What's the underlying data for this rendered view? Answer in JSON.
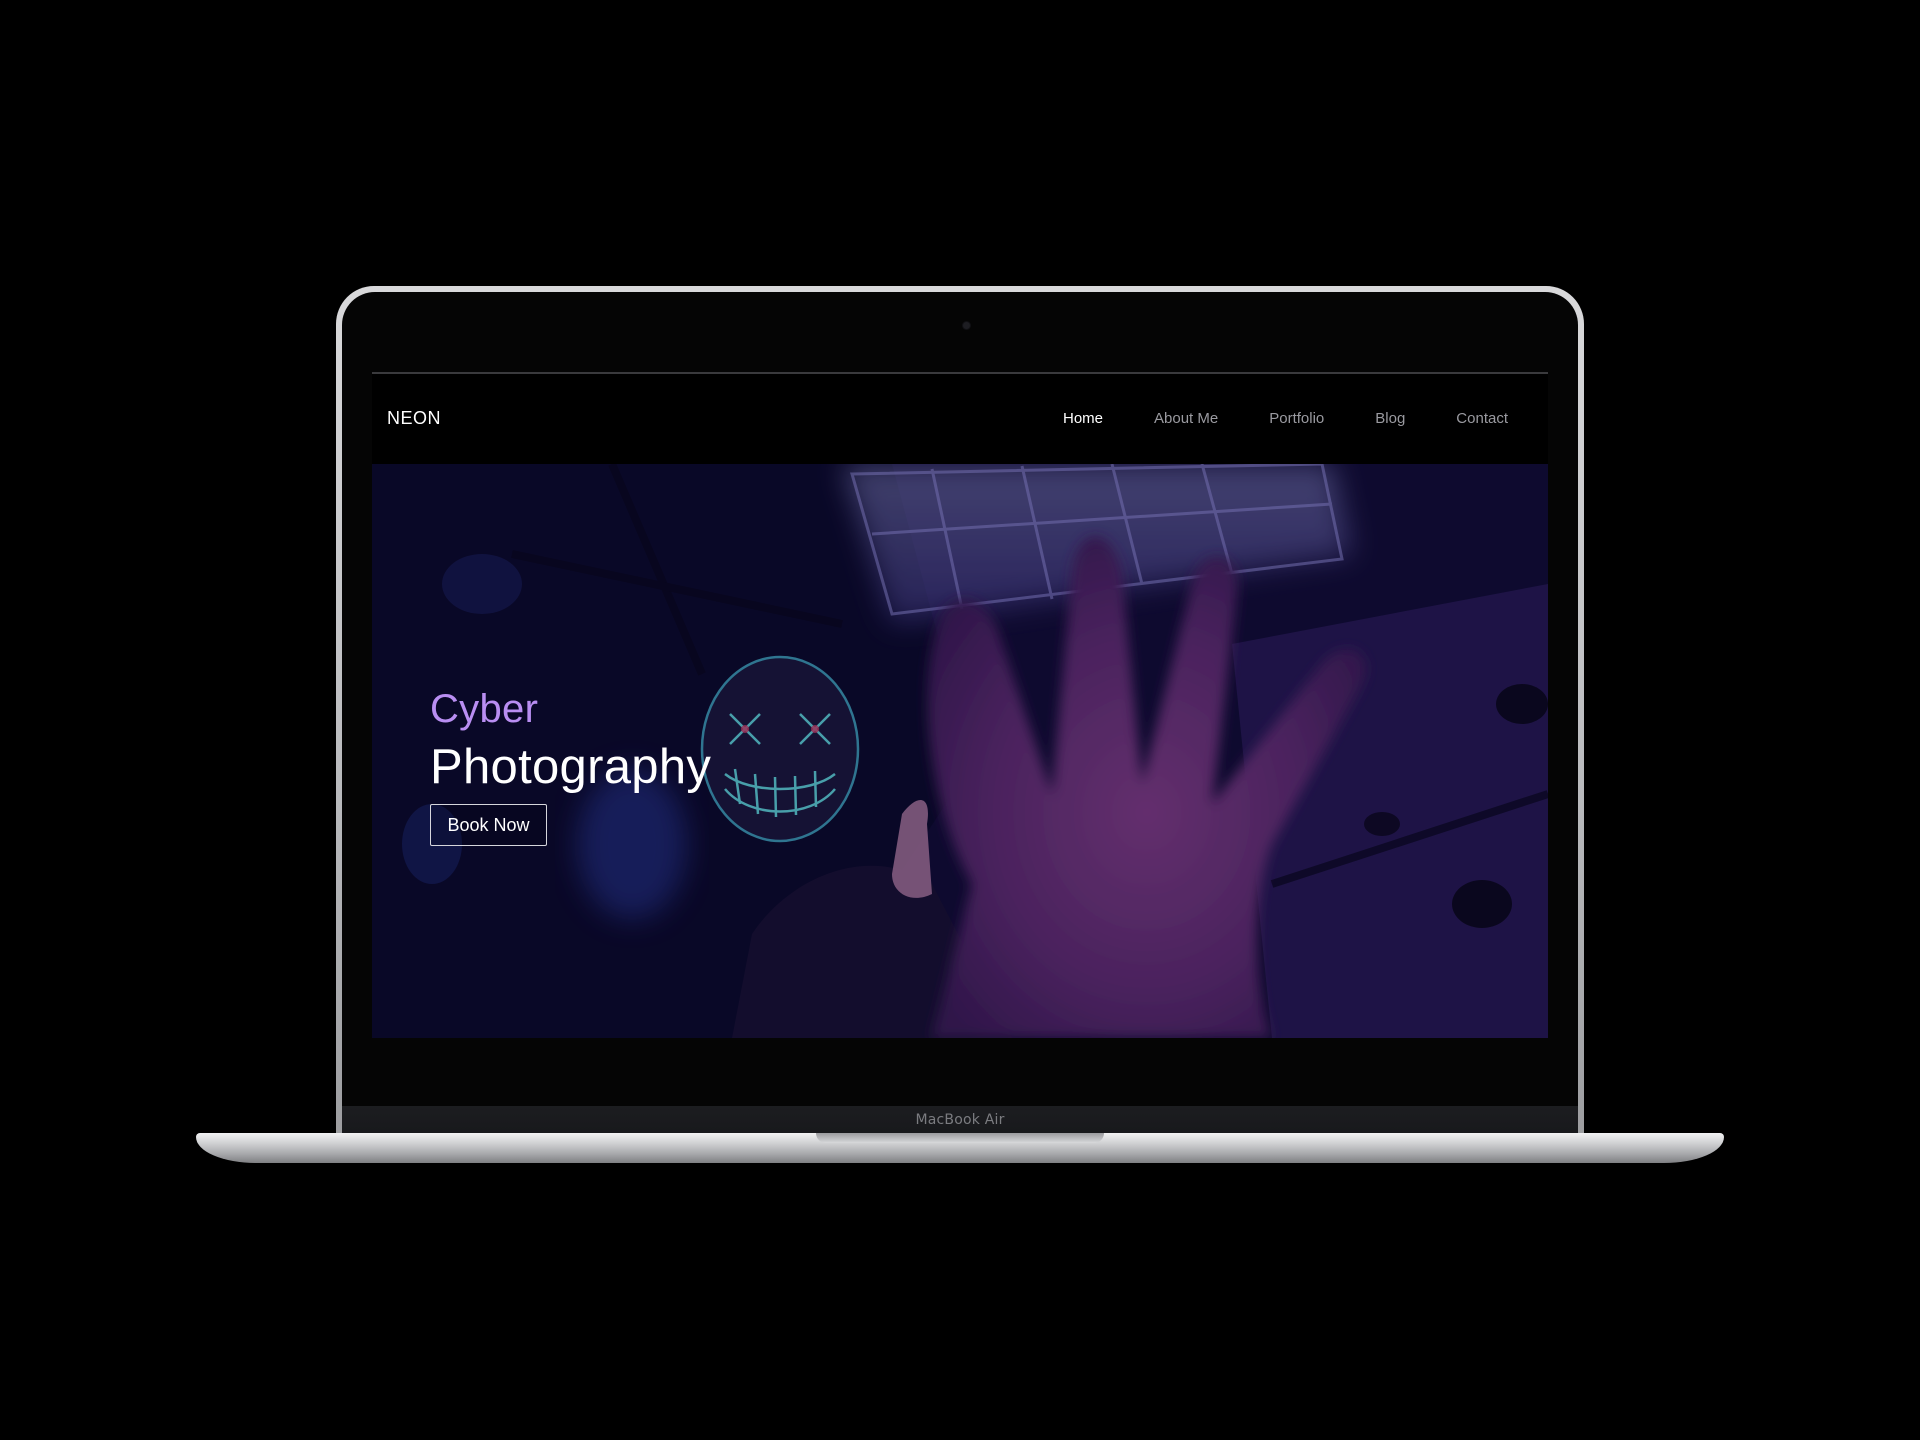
{
  "device": {
    "label": "MacBook Air"
  },
  "site": {
    "brand": "NEON",
    "nav": [
      {
        "label": "Home",
        "active": true
      },
      {
        "label": "About Me",
        "active": false
      },
      {
        "label": "Portfolio",
        "active": false
      },
      {
        "label": "Blog",
        "active": false
      },
      {
        "label": "Contact",
        "active": false
      }
    ],
    "hero": {
      "kicker": "Cyber",
      "title": "Photography",
      "button": "Book Now"
    }
  },
  "colors": {
    "page_background": "#000000",
    "accent": "#b98ef2",
    "nav_active": "#ffffff",
    "nav_inactive": "#9a9aa0"
  }
}
